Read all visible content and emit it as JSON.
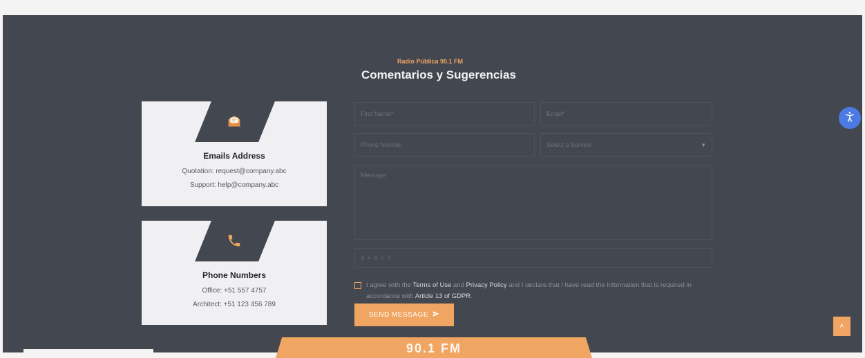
{
  "header": {
    "eyebrow": "Radio Pública 90.1 FM",
    "title": "Comentarios y Sugerencias"
  },
  "contact_cards": {
    "email": {
      "icon": "envelope-icon",
      "title": "Emails Address",
      "line1": "Quotation: request@company.abc",
      "line2": "Support: help@company.abc"
    },
    "phone": {
      "icon": "phone-icon",
      "title": "Phone Numbers",
      "line1": "Office: +51 557 4757",
      "line2": "Architect: +51 123 456 789"
    }
  },
  "form": {
    "first_name_placeholder": "First Name*",
    "email_placeholder": "Email*",
    "phone_placeholder": "Phone Number",
    "service_placeholder": "Select a Service",
    "message_placeholder": "Message",
    "captcha_text": "3 + 6 = ?",
    "consent": {
      "prefix": "I agree with the",
      "terms": "Terms of Use",
      "and": "and",
      "privacy": "Privacy Policy",
      "middle": "and I declare that I have read the information that is required in accordance with",
      "article": "Article 13 of GDPR",
      "suffix": "."
    },
    "submit_label": "SEND MESSAGE"
  },
  "banner": {
    "text": "90.1 FM"
  },
  "colors": {
    "accent": "#f0a562",
    "panel": "#43474f",
    "card": "#f0f0f2",
    "accessibility": "#4b7ae3"
  }
}
